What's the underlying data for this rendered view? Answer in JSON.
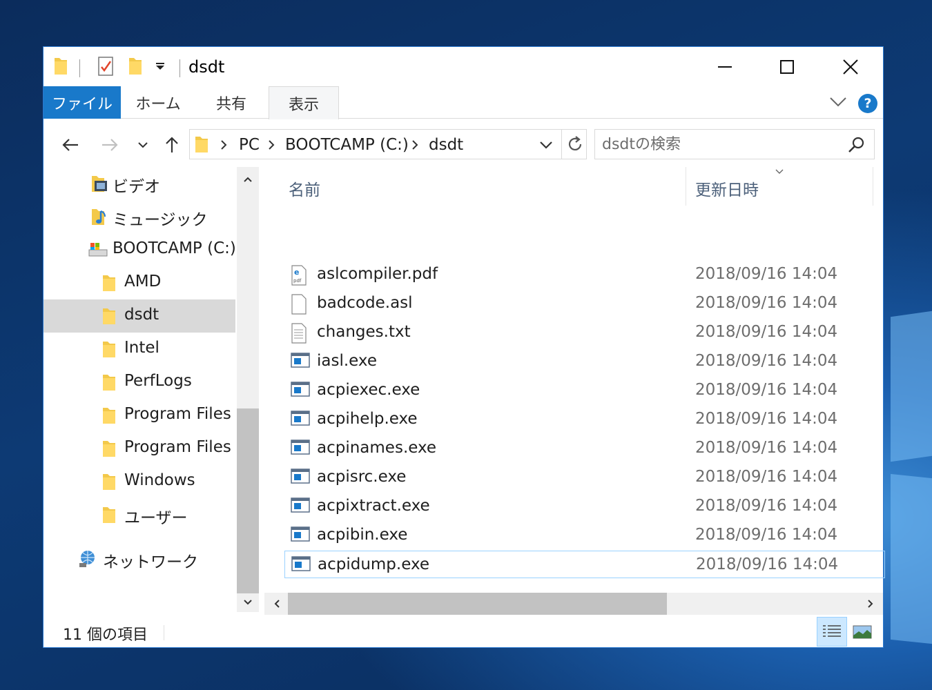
{
  "window": {
    "title": "dsdt"
  },
  "ribbon": {
    "tabs": [
      "ファイル",
      "ホーム",
      "共有",
      "表示"
    ]
  },
  "address": {
    "crumbs": [
      "PC",
      "BOOTCAMP (C:)",
      "dsdt"
    ]
  },
  "search": {
    "placeholder": "dsdtの検索"
  },
  "nav": {
    "items": [
      {
        "label": "ビデオ",
        "icon": "video-folder-icon"
      },
      {
        "label": "ミュージック",
        "icon": "music-folder-icon"
      },
      {
        "label": "BOOTCAMP (C:)",
        "icon": "drive-icon"
      },
      {
        "label": "AMD",
        "icon": "folder-icon"
      },
      {
        "label": "dsdt",
        "icon": "folder-icon",
        "selected": true
      },
      {
        "label": "Intel",
        "icon": "folder-icon"
      },
      {
        "label": "PerfLogs",
        "icon": "folder-icon"
      },
      {
        "label": "Program Files",
        "icon": "folder-icon"
      },
      {
        "label": "Program Files (:",
        "icon": "folder-icon"
      },
      {
        "label": "Windows",
        "icon": "folder-icon"
      },
      {
        "label": "ユーザー",
        "icon": "folder-icon"
      },
      {
        "label": "ネットワーク",
        "icon": "network-icon"
      }
    ]
  },
  "filelist": {
    "columns": {
      "name": "名前",
      "date": "更新日時"
    },
    "files": [
      {
        "name": "aslcompiler.pdf",
        "date": "2018/09/16 14:04",
        "icon": "pdf-file-icon"
      },
      {
        "name": "badcode.asl",
        "date": "2018/09/16 14:04",
        "icon": "blank-file-icon"
      },
      {
        "name": "changes.txt",
        "date": "2018/09/16 14:04",
        "icon": "text-file-icon"
      },
      {
        "name": "iasl.exe",
        "date": "2018/09/16 14:04",
        "icon": "exe-file-icon"
      },
      {
        "name": "acpiexec.exe",
        "date": "2018/09/16 14:04",
        "icon": "exe-file-icon"
      },
      {
        "name": "acpihelp.exe",
        "date": "2018/09/16 14:04",
        "icon": "exe-file-icon"
      },
      {
        "name": "acpinames.exe",
        "date": "2018/09/16 14:04",
        "icon": "exe-file-icon"
      },
      {
        "name": "acpisrc.exe",
        "date": "2018/09/16 14:04",
        "icon": "exe-file-icon"
      },
      {
        "name": "acpixtract.exe",
        "date": "2018/09/16 14:04",
        "icon": "exe-file-icon"
      },
      {
        "name": "acpibin.exe",
        "date": "2018/09/16 14:04",
        "icon": "exe-file-icon"
      },
      {
        "name": "acpidump.exe",
        "date": "2018/09/16 14:04",
        "icon": "exe-file-icon",
        "focused": true
      }
    ]
  },
  "status": {
    "item_count": "11 個の項目"
  },
  "colors": {
    "accent": "#1979ca",
    "selection": "#d9d9d9",
    "focus_border": "#99d1ff"
  }
}
